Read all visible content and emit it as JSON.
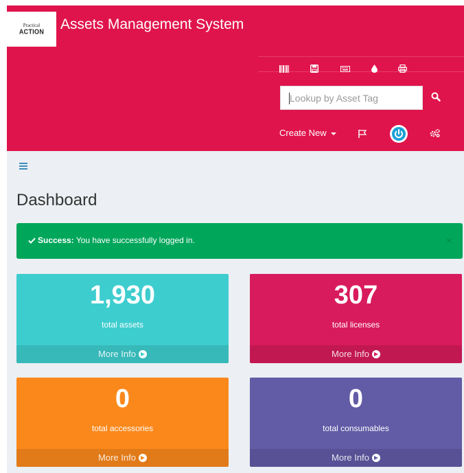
{
  "app": {
    "logo_line1": "Practical",
    "logo_line2": "ACTION",
    "title": "Assets Management System"
  },
  "toolbar": {
    "icons": [
      "barcode-icon",
      "save-icon",
      "keyboard-icon",
      "tint-icon",
      "print-icon"
    ]
  },
  "search": {
    "placeholder": "Lookup by Asset Tag"
  },
  "nav": {
    "create_new": "Create New"
  },
  "page": {
    "title": "Dashboard"
  },
  "alert": {
    "strong": "Success:",
    "message": " You have successfully logged in.",
    "close": "×",
    "color": "#00a65a"
  },
  "boxes": [
    {
      "value": "1,930",
      "label": "total assets",
      "more": "More Info",
      "color": "#3ecdcf"
    },
    {
      "value": "307",
      "label": "total licenses",
      "more": "More Info",
      "color": "#d81b5c"
    },
    {
      "value": "0",
      "label": "total accessories",
      "more": "More Info",
      "color": "#fb881b"
    },
    {
      "value": "0",
      "label": "total consumables",
      "more": "More Info",
      "color": "#625ba6"
    }
  ],
  "colors": {
    "header": "#e0144c",
    "content_bg": "#eceff3",
    "power": "#1aa1d6"
  }
}
